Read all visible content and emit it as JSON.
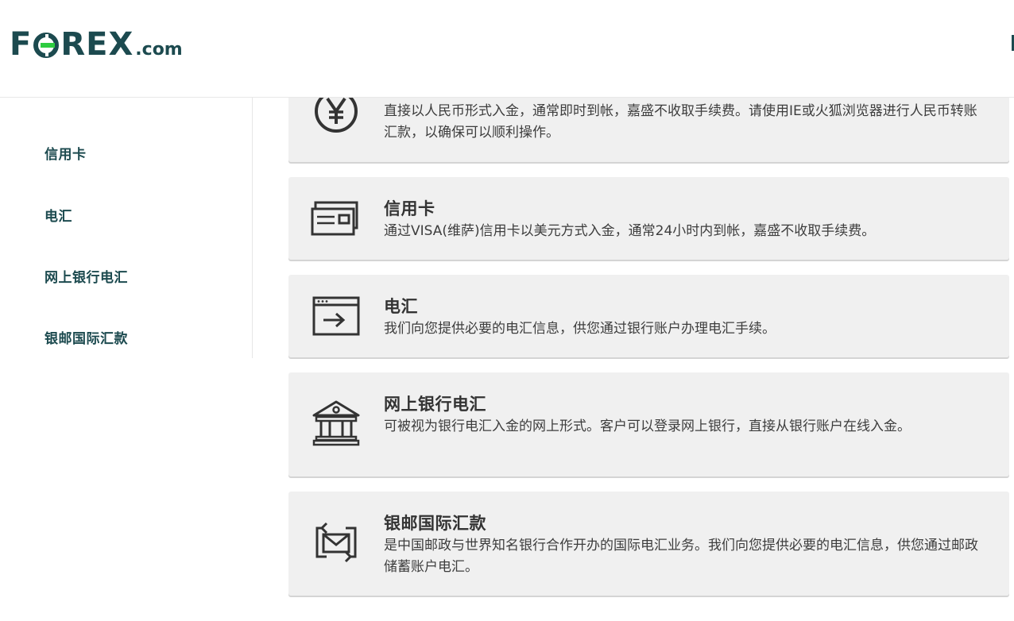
{
  "header": {
    "logo": {
      "brand": "FOREX",
      "suffix": ".com"
    }
  },
  "sidebar": {
    "items": [
      {
        "label": "信用卡"
      },
      {
        "label": "电汇"
      },
      {
        "label": "网上银行电汇"
      },
      {
        "label": "银邮国际汇款"
      }
    ]
  },
  "methods": [
    {
      "icon": "yuan-icon",
      "title": "",
      "desc": "直接以人民币形式入金，通常即时到帐，嘉盛不收取手续费。请使用IE或火狐浏览器进行人民币转账汇款，以确保可以顺利操作。"
    },
    {
      "icon": "credit-card-icon",
      "title": "信用卡",
      "desc": "通过VISA(维萨)信用卡以美元方式入金，通常24小时内到帐，嘉盛不收取手续费。"
    },
    {
      "icon": "wire-transfer-icon",
      "title": "电汇",
      "desc": "我们向您提供必要的电汇信息，供您通过银行账户办理电汇手续。"
    },
    {
      "icon": "bank-icon",
      "title": "网上银行电汇",
      "desc": "可被视为银行电汇入金的网上形式。客户可以登录网上银行，直接从银行账户在线入金。"
    },
    {
      "icon": "envelope-exchange-icon",
      "title": "银邮国际汇款",
      "desc": "是中国邮政与世界知名银行合作开办的国际电汇业务。我们向您提供必要的电汇信息，供您通过邮政储蓄账户电汇。"
    }
  ],
  "colors": {
    "brand": "#1c4a4f",
    "accent": "#2ecc40",
    "card_bg": "#f0f0f0"
  }
}
